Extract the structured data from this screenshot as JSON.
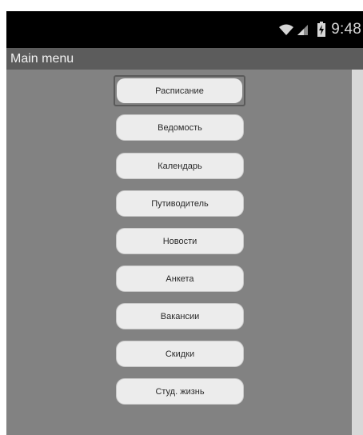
{
  "status_bar": {
    "time": "9:48",
    "icons": [
      "wifi-icon",
      "signal-icon",
      "battery-icon"
    ]
  },
  "action_bar": {
    "title": "Main menu"
  },
  "menu": {
    "items": [
      {
        "label": "Расписание"
      },
      {
        "label": "Ведомость"
      },
      {
        "label": "Календарь"
      },
      {
        "label": "Путиводитель"
      },
      {
        "label": "Новости"
      },
      {
        "label": "Анкета"
      },
      {
        "label": "Вакансии"
      },
      {
        "label": "Скидки"
      },
      {
        "label": "Студ. жизнь"
      }
    ]
  },
  "colors": {
    "status_bar": "#000000",
    "action_bar": "#5c5c5c",
    "content_bg": "#828282",
    "button_bg": "#ececec",
    "scroll_track": "#d8d8d8"
  }
}
